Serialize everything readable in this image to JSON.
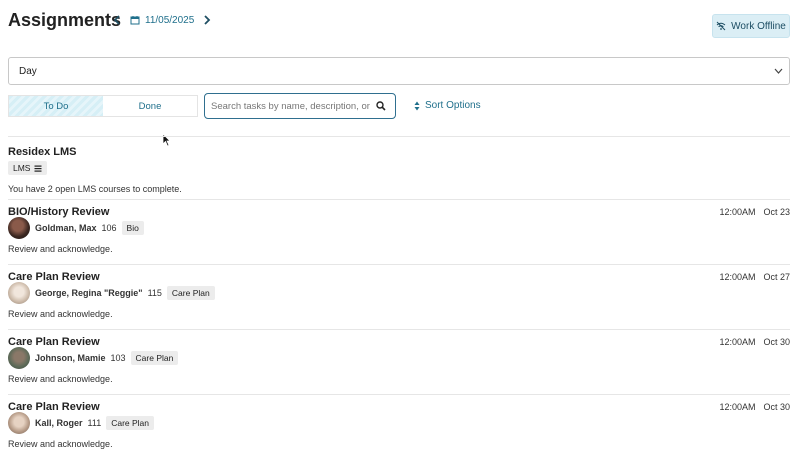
{
  "header": {
    "title": "Assignments",
    "date": "11/05/2025",
    "offline_label": "Work Offline"
  },
  "view_select": {
    "value": "Day"
  },
  "filters": {
    "todo_label": "To Do",
    "done_label": "Done",
    "search_placeholder": "Search tasks by name, description, or resi",
    "sort_label": "Sort Options"
  },
  "lms": {
    "title": "Residex LMS",
    "tag": "LMS",
    "description": "You have 2 open LMS courses to complete."
  },
  "tasks": [
    {
      "title": "BIO/History Review",
      "time": "12:00AM",
      "date": "Oct 23",
      "person": "Goldman, Max",
      "room": "106",
      "tag": "Bio",
      "description": "Review and acknowledge."
    },
    {
      "title": "Care Plan Review",
      "time": "12:00AM",
      "date": "Oct 27",
      "person": "George, Regina \"Reggie\"",
      "room": "115",
      "tag": "Care Plan",
      "description": "Review and acknowledge."
    },
    {
      "title": "Care Plan Review",
      "time": "12:00AM",
      "date": "Oct 30",
      "person": "Johnson, Mamie",
      "room": "103",
      "tag": "Care Plan",
      "description": "Review and acknowledge."
    },
    {
      "title": "Care Plan Review",
      "time": "12:00AM",
      "date": "Oct 30",
      "person": "Kall, Roger",
      "room": "111",
      "tag": "Care Plan",
      "description": "Review and acknowledge."
    }
  ],
  "colors": {
    "accent": "#1f6f8b",
    "offline_bg": "#dbeef5",
    "search_border": "#2f6f8f",
    "tag_bg": "#ececec"
  },
  "icons": {
    "prev": "chevron-left-icon",
    "next": "chevron-right-icon",
    "calendar": "calendar-icon",
    "offline": "wifi-off-icon",
    "dropdown": "chevron-down-icon",
    "search": "search-icon",
    "sort": "sort-icon",
    "menu": "menu-icon"
  }
}
